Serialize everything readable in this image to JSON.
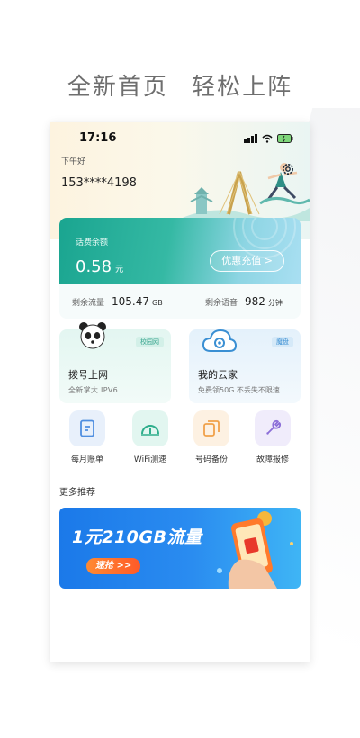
{
  "headline": {
    "part1": "全新首页",
    "part2": "轻松上阵"
  },
  "status_bar": {
    "time": "17:16"
  },
  "header": {
    "greeting": "下午好",
    "phone_number": "153****4198"
  },
  "balance": {
    "label": "话费余额",
    "amount": "0.58",
    "unit": "元",
    "recharge_label": "优惠充值 >"
  },
  "usage": {
    "data": {
      "label": "剩余流量",
      "value": "105.47",
      "unit": "GB"
    },
    "voice": {
      "label": "剩余语音",
      "value": "982",
      "unit": "分钟"
    }
  },
  "services": [
    {
      "title": "拨号上网",
      "subtitle": "全新掌大 IPV6",
      "tag": "校园网"
    },
    {
      "title": "我的云家",
      "subtitle": "免费领50G 不丢失不限速",
      "tag": "魔盘"
    }
  ],
  "quick_actions": [
    {
      "label": "每月账单",
      "icon": "bill-icon"
    },
    {
      "label": "WiFi测速",
      "icon": "speedometer-icon"
    },
    {
      "label": "号码备份",
      "icon": "backup-icon"
    },
    {
      "label": "故障报修",
      "icon": "wrench-icon"
    }
  ],
  "more": {
    "title": "更多推荐"
  },
  "banner": {
    "title": "1元210GB流量",
    "button": "速抢 >>"
  },
  "colors": {
    "accent": "#1aa590",
    "banner": "#1b79e9",
    "cta": "#ff6a2a"
  }
}
